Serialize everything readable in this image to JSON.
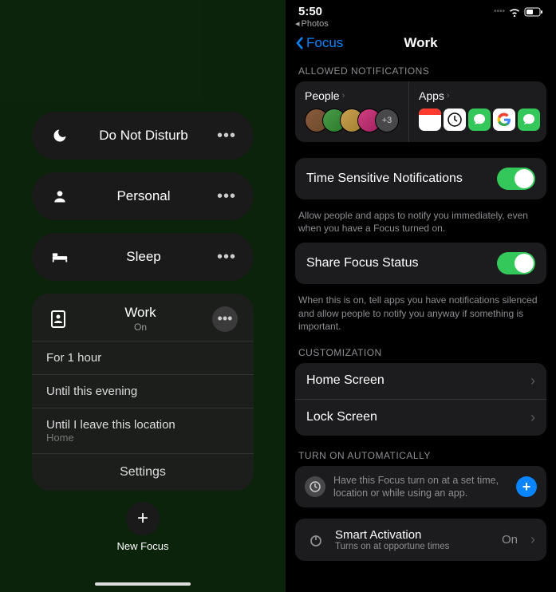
{
  "status_bar": {
    "time": "5:50",
    "back_app": "Photos"
  },
  "left": {
    "modes": [
      {
        "id": "dnd",
        "label": "Do Not Disturb"
      },
      {
        "id": "personal",
        "label": "Personal"
      },
      {
        "id": "sleep",
        "label": "Sleep"
      }
    ],
    "active": {
      "label": "Work",
      "status": "On",
      "options": [
        {
          "label": "For 1 hour"
        },
        {
          "label": "Until this evening"
        },
        {
          "label": "Until I leave this location",
          "sub": "Home"
        }
      ],
      "settings_label": "Settings"
    },
    "new_focus_label": "New Focus"
  },
  "right": {
    "back_label": "Focus",
    "title": "Work",
    "sections": {
      "allowed_header": "ALLOWED NOTIFICATIONS",
      "people_label": "People",
      "apps_label": "Apps",
      "people_more": "+3",
      "time_sensitive": {
        "label": "Time Sensitive Notifications",
        "desc": "Allow people and apps to notify you immediately, even when you have a Focus turned on."
      },
      "share_status": {
        "label": "Share Focus Status",
        "desc": "When this is on, tell apps you have notifications silenced and allow people to notify you anyway if something is important."
      },
      "customization_header": "CUSTOMIZATION",
      "home_screen": "Home Screen",
      "lock_screen": "Lock Screen",
      "auto_header": "TURN ON AUTOMATICALLY",
      "auto_desc": "Have this Focus turn on at a set time, location or while using an app.",
      "smart": {
        "title": "Smart Activation",
        "sub": "Turns on at opportune times",
        "value": "On"
      }
    }
  }
}
